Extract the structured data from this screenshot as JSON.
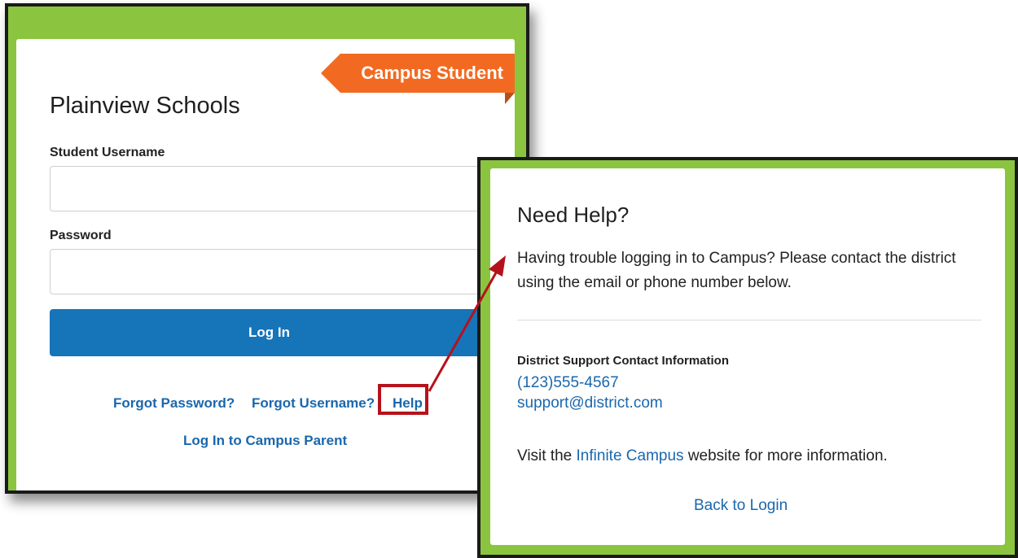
{
  "login": {
    "ribbon_label": "Campus Student",
    "school_name": "Plainview Schools",
    "username_label": "Student Username",
    "username_value": "",
    "password_label": "Password",
    "password_value": "",
    "login_button": "Log In",
    "links": {
      "forgot_password": "Forgot Password?",
      "forgot_username": "Forgot Username?",
      "help": "Help",
      "campus_parent": "Log In to Campus Parent"
    }
  },
  "help": {
    "title": "Need Help?",
    "description": "Having trouble logging in to Campus? Please contact the district using the email or phone number below.",
    "contact_heading": "District Support Contact Information",
    "phone": "(123)555-4567",
    "email": "support@district.com",
    "visit_prefix": "Visit the ",
    "visit_link": "Infinite Campus",
    "visit_suffix": " website for more information.",
    "back_link": "Back to Login"
  },
  "colors": {
    "brand_green": "#8bc53f",
    "ribbon_orange": "#f26a21",
    "primary_blue": "#1674b9",
    "link_blue": "#1a67ad",
    "annotation_red": "#b5121b"
  }
}
